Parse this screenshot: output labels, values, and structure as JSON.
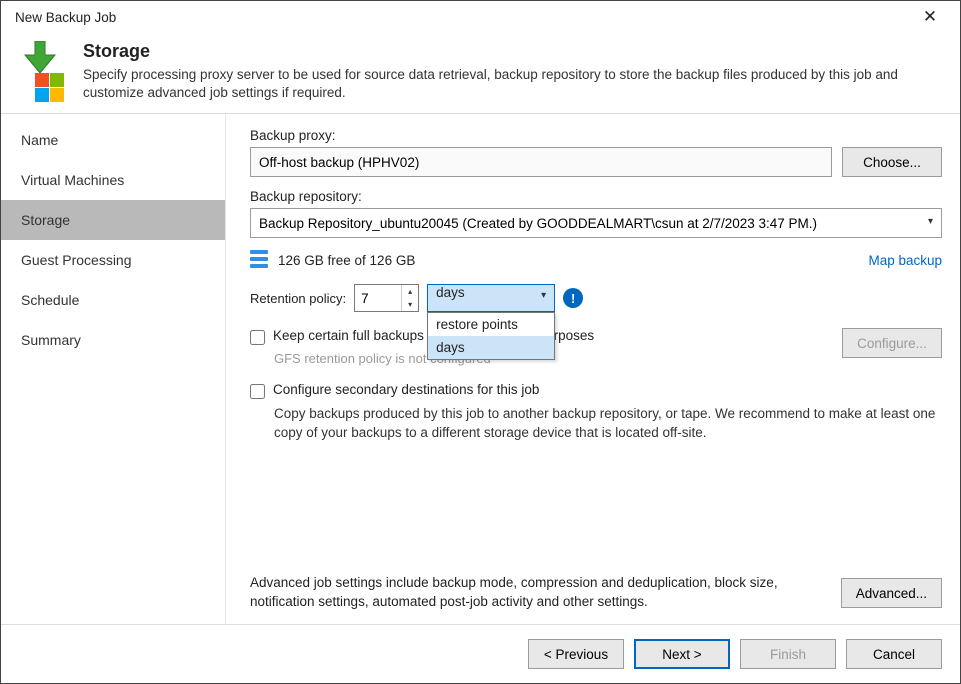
{
  "window": {
    "title": "New Backup Job"
  },
  "header": {
    "title": "Storage",
    "subtitle": "Specify processing proxy server to be used for source data retrieval, backup repository to store the backup files produced by this job and customize advanced job settings if required."
  },
  "nav": {
    "items": [
      {
        "label": "Name"
      },
      {
        "label": "Virtual Machines"
      },
      {
        "label": "Storage"
      },
      {
        "label": "Guest Processing"
      },
      {
        "label": "Schedule"
      },
      {
        "label": "Summary"
      }
    ],
    "active_index": 2
  },
  "proxy": {
    "label": "Backup proxy:",
    "value": "Off-host backup (HPHV02)",
    "choose_button": "Choose..."
  },
  "repository": {
    "label": "Backup repository:",
    "value": "Backup Repository_ubuntu20045 (Created by GOODDEALMART\\csun at 2/7/2023 3:47 PM.)"
  },
  "storage_info": {
    "free_text": "126 GB free of 126 GB",
    "map_link": "Map backup"
  },
  "retention": {
    "label": "Retention policy:",
    "value": "7",
    "unit": "days",
    "dropdown_options": [
      "restore points",
      "days"
    ]
  },
  "gfs": {
    "checkbox_label": "Keep certain full backups longer for archival purposes",
    "configure_button": "Configure...",
    "hint": "GFS retention policy is not configured"
  },
  "secondary": {
    "checkbox_label": "Configure secondary destinations for this job",
    "description": "Copy backups produced by this job to another backup repository, or tape. We recommend to make at least one copy of your backups to a different storage device that is located off-site."
  },
  "advanced": {
    "text": "Advanced job settings include backup mode, compression and deduplication, block size, notification settings, automated post-job activity and other settings.",
    "button": "Advanced..."
  },
  "footer": {
    "previous": "< Previous",
    "next": "Next >",
    "finish": "Finish",
    "cancel": "Cancel"
  }
}
